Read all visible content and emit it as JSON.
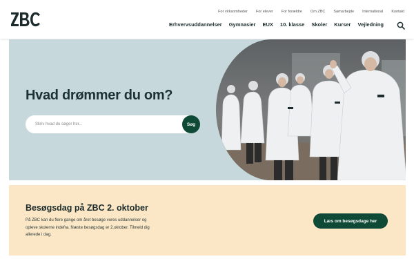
{
  "brand": {
    "logo_text": "ZBC"
  },
  "utility_nav": [
    "For virksomheder",
    "For elever",
    "For forældre",
    "Om ZBC",
    "Samarbejde",
    "International",
    "Kontakt"
  ],
  "main_nav": [
    "Erhvervsuddannelser",
    "Gymnasier",
    "EUX",
    "10. klasse",
    "Skoler",
    "Kurser",
    "Vejledning"
  ],
  "hero": {
    "title": "Hvad drømmer du om?",
    "search_placeholder": "Skriv hvad du søger her...",
    "search_button": "Søg"
  },
  "event_card": {
    "title": "Besøgsdag på ZBC 2. oktober",
    "text": "På ZBC kan du flere gange om året besøge vores uddannelser og opleve skolerne indefra. Næste besøgsdag er 2.oktober. Tilmeld dig allerede i dag.",
    "button": "Læs om besøgsdage her"
  },
  "colors": {
    "brand_green": "#0e4a36",
    "hero_bg": "#c7d8dd",
    "card_bg": "#fbe7c6"
  },
  "icons": {
    "search": "search-icon"
  }
}
